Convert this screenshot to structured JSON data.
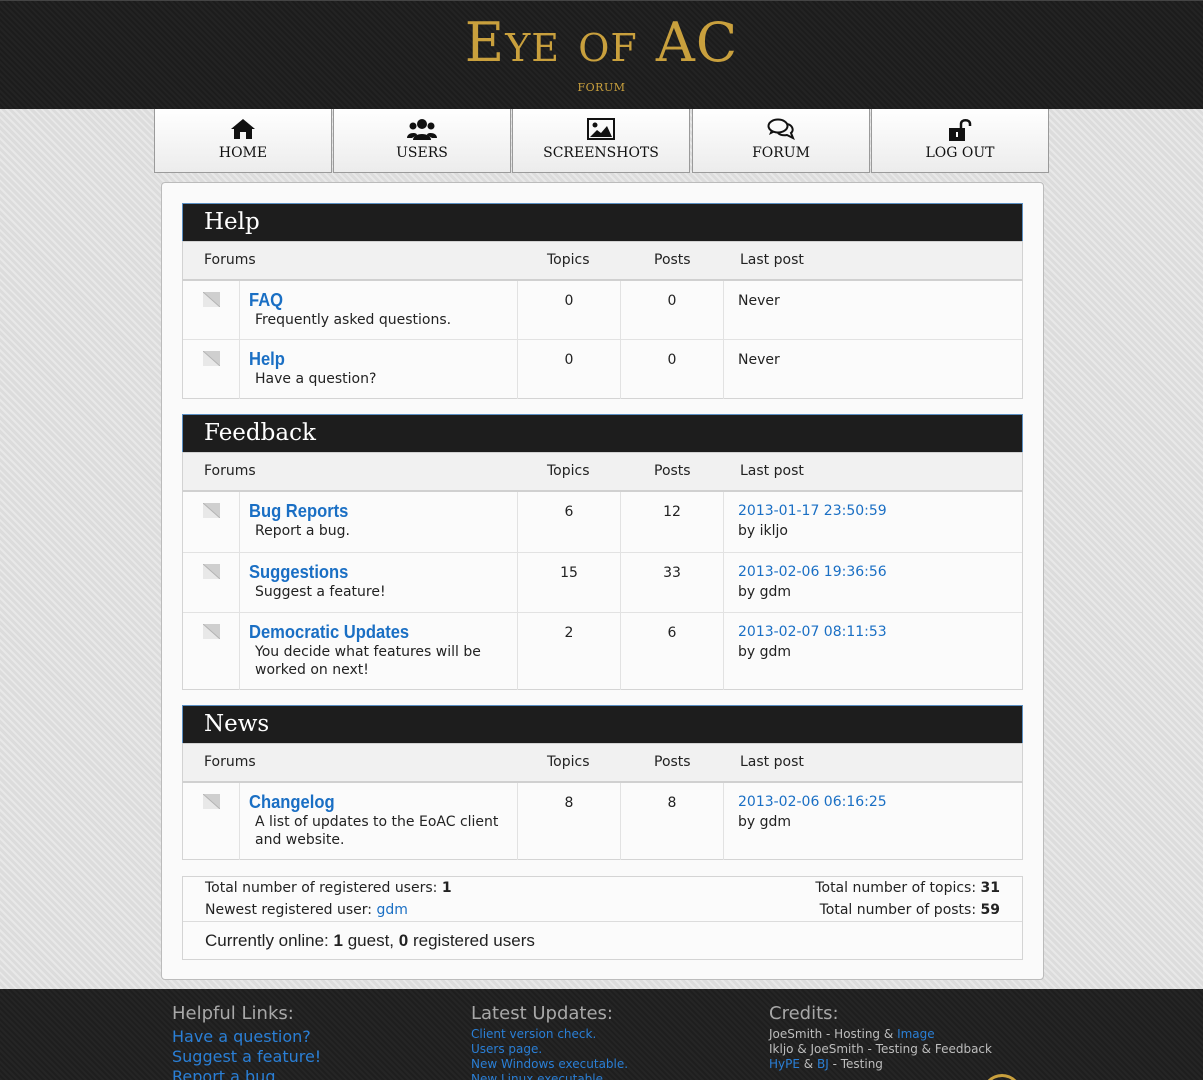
{
  "header": {
    "title": "Eye of AC",
    "subtitle": "FORUM"
  },
  "nav": [
    {
      "label": "HOME",
      "icon": "home-icon"
    },
    {
      "label": "USERS",
      "icon": "users-icon"
    },
    {
      "label": "SCREENSHOTS",
      "icon": "image-icon"
    },
    {
      "label": "FORUM",
      "icon": "comments-icon"
    },
    {
      "label": "LOG OUT",
      "icon": "unlock-icon"
    }
  ],
  "columns": {
    "forums": "Forums",
    "topics": "Topics",
    "posts": "Posts",
    "last_post": "Last post"
  },
  "sections": [
    {
      "title": "Help",
      "rows": [
        {
          "title": "FAQ",
          "desc": "Frequently asked questions.",
          "topics": "0",
          "posts": "0",
          "last_post": "Never"
        },
        {
          "title": "Help",
          "desc": "Have a question?",
          "topics": "0",
          "posts": "0",
          "last_post": "Never"
        }
      ]
    },
    {
      "title": "Feedback",
      "rows": [
        {
          "title": "Bug Reports",
          "desc": "Report a bug.",
          "topics": "6",
          "posts": "12",
          "last_date": "2013-01-17 23:50:59",
          "last_by": "by ikljo"
        },
        {
          "title": "Suggestions",
          "desc": "Suggest a feature!",
          "topics": "15",
          "posts": "33",
          "last_date": "2013-02-06 19:36:56",
          "last_by": "by gdm"
        },
        {
          "title": "Democratic Updates",
          "desc": "You decide what features will be worked on next!",
          "topics": "2",
          "posts": "6",
          "last_date": "2013-02-07 08:11:53",
          "last_by": "by gdm"
        }
      ]
    },
    {
      "title": "News",
      "rows": [
        {
          "title": "Changelog",
          "desc": "A list of updates to the EoAC client and website.",
          "topics": "8",
          "posts": "8",
          "last_date": "2013-02-06 06:16:25",
          "last_by": "by gdm"
        }
      ]
    }
  ],
  "stats": {
    "registered_label": "Total number of registered users:",
    "registered_value": "1",
    "newest_label": "Newest registered user:",
    "newest_value": "gdm",
    "topics_label": "Total number of topics:",
    "topics_value": "31",
    "posts_label": "Total number of posts:",
    "posts_value": "59",
    "online_prefix": "Currently online:",
    "online_guests": "1",
    "online_guest_word": "guest,",
    "online_registered": "0",
    "online_registered_word": "registered users"
  },
  "footer": {
    "helpful_title": "Helpful Links:",
    "helpful_links": [
      "Have a question?",
      "Suggest a feature!",
      "Report a bug."
    ],
    "updates_title": "Latest Updates:",
    "updates_links": [
      "Client version check.",
      "Users page.",
      "New Windows executable.",
      "New Linux executable."
    ],
    "credits_title": "Credits:",
    "credits": {
      "line1_text": "JoeSmith - Hosting &",
      "line1_link": "Image",
      "line2_text": "Ikljo & JoeSmith - Testing & Feedback",
      "line3_link1": "HyPE",
      "line3_amp": "&",
      "line3_link2": "BJ",
      "line3_text": "- Testing"
    }
  },
  "colors": {
    "accent_gold": "#c9a03d",
    "link_blue": "#1a6fc4",
    "header_bg": "#1c1c1c"
  }
}
